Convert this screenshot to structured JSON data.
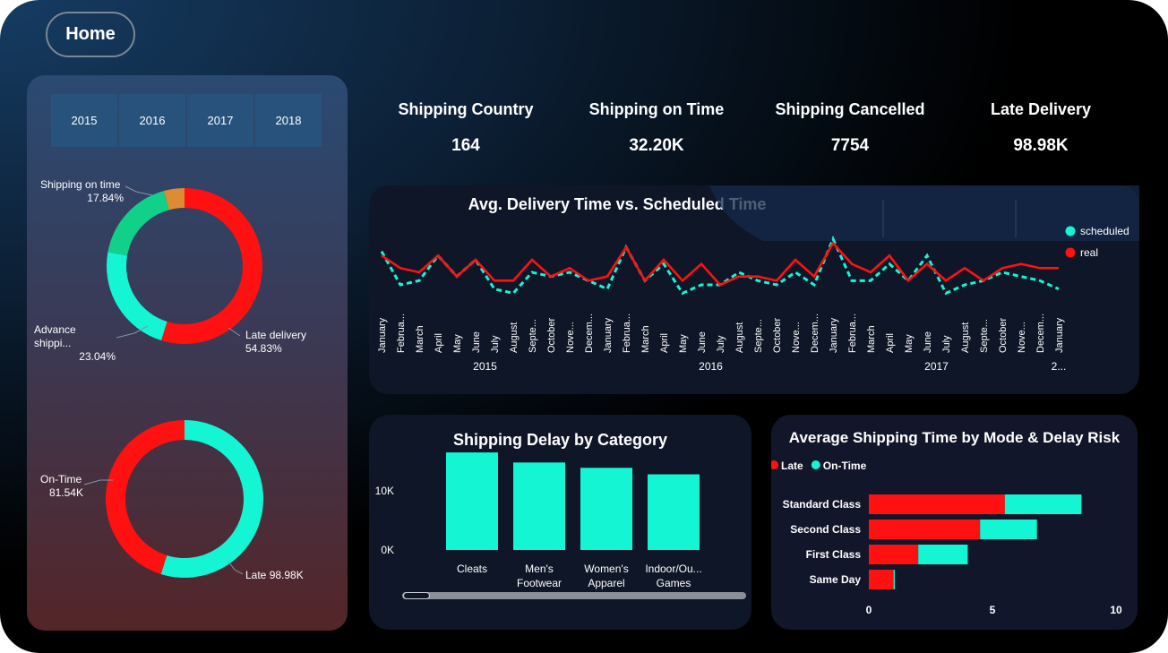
{
  "nav": {
    "home_label": "Home"
  },
  "year_filter": [
    "2015",
    "2016",
    "2017",
    "2018"
  ],
  "donut_status": {
    "labels": [
      {
        "name": "Shipping on time",
        "value": "17.84%"
      },
      {
        "name": "Advance shippi...",
        "value": "23.04%"
      },
      {
        "name": "Late delivery",
        "value": "54.83%"
      }
    ],
    "segments": [
      {
        "name": "Late delivery",
        "percent": 54.83,
        "color": "#ff1111"
      },
      {
        "name": "Advance shipping",
        "percent": 23.04,
        "color": "#14f5d4"
      },
      {
        "name": "Shipping on time",
        "percent": 17.84,
        "color": "#10d08a"
      },
      {
        "name": "Shipping canceled",
        "percent": 4.29,
        "color": "#dd8c34"
      }
    ]
  },
  "donut_ontime": {
    "labels": [
      {
        "name": "On-Time",
        "value": "81.54K"
      },
      {
        "name": "Late",
        "value": "98.98K"
      }
    ],
    "segments": [
      {
        "name": "Late",
        "value": 98.98,
        "color": "#14f5d4"
      },
      {
        "name": "On-Time",
        "value": 81.54,
        "color": "#ff1111"
      }
    ]
  },
  "kpis": [
    {
      "title": "Shipping Country",
      "value": "164"
    },
    {
      "title": "Shipping on Time",
      "value": "32.20K"
    },
    {
      "title": "Shipping Cancelled",
      "value": "7754"
    },
    {
      "title": "Late Delivery",
      "value": "98.98K"
    }
  ],
  "chart_data": [
    {
      "type": "line",
      "title": "Avg. Delivery Time vs. Scheduled Time",
      "x": [
        "January",
        "Februa...",
        "March",
        "April",
        "May",
        "June",
        "July",
        "August",
        "Septe...",
        "October",
        "Nove...",
        "Decem...",
        "January",
        "Februa...",
        "March",
        "April",
        "May",
        "June",
        "July",
        "August",
        "Septe...",
        "October",
        "Nove...",
        "Decem...",
        "January",
        "Februa...",
        "March",
        "April",
        "May",
        "June",
        "July",
        "August",
        "Septe...",
        "October",
        "Nove...",
        "Decem...",
        "January"
      ],
      "x_groups": [
        {
          "label": "2015",
          "start": 0,
          "end": 11
        },
        {
          "label": "2016",
          "start": 12,
          "end": 23
        },
        {
          "label": "2017",
          "start": 24,
          "end": 35
        },
        {
          "label": "2...",
          "start": 36,
          "end": 36
        }
      ],
      "series": [
        {
          "name": "scheduled",
          "color": "#14f5d4",
          "dashed": true,
          "values": [
            3.52,
            3.44,
            3.45,
            3.51,
            3.46,
            3.5,
            3.43,
            3.42,
            3.47,
            3.46,
            3.47,
            3.45,
            3.43,
            3.53,
            3.45,
            3.49,
            3.42,
            3.44,
            3.44,
            3.47,
            3.45,
            3.44,
            3.47,
            3.44,
            3.55,
            3.45,
            3.45,
            3.49,
            3.45,
            3.51,
            3.42,
            3.44,
            3.45,
            3.47,
            3.46,
            3.45,
            3.43
          ]
        },
        {
          "name": "real",
          "color": "#ff1111",
          "dashed": false,
          "values": [
            3.51,
            3.48,
            3.47,
            3.51,
            3.46,
            3.5,
            3.45,
            3.45,
            3.5,
            3.46,
            3.48,
            3.45,
            3.46,
            3.53,
            3.45,
            3.5,
            3.45,
            3.49,
            3.44,
            3.46,
            3.46,
            3.45,
            3.5,
            3.46,
            3.54,
            3.49,
            3.47,
            3.51,
            3.45,
            3.49,
            3.45,
            3.48,
            3.45,
            3.48,
            3.49,
            3.48,
            3.48
          ]
        }
      ],
      "legend": "top-right"
    },
    {
      "type": "bar",
      "title": "Shipping Delay by Category",
      "categories": [
        [
          "Cleats"
        ],
        [
          "Men's",
          "Footwear"
        ],
        [
          "Women's",
          "Apparel"
        ],
        [
          "Indoor/Ou...",
          "Games"
        ]
      ],
      "values": [
        16500,
        14800,
        13900,
        12800
      ],
      "yticks": [
        {
          "value": 0,
          "label": "0K"
        },
        {
          "value": 10000,
          "label": "10K"
        }
      ],
      "color": "#14f5d4"
    },
    {
      "type": "bar",
      "orientation": "horizontal",
      "stacked": true,
      "title": "Average Shipping Time by Mode & Delay Risk",
      "categories": [
        "Standard Class",
        "Second Class",
        "First Class",
        "Same Day"
      ],
      "series": [
        {
          "name": "Late",
          "color": "#ff1111",
          "values": [
            5.5,
            4.5,
            2.0,
            1.0
          ]
        },
        {
          "name": "On-Time",
          "color": "#14f5d4",
          "values": [
            3.1,
            2.3,
            2.0,
            0.05
          ]
        }
      ],
      "xticks": [
        "0",
        "5",
        "10"
      ],
      "xlim": [
        0,
        10
      ],
      "legend": "top-left"
    }
  ]
}
